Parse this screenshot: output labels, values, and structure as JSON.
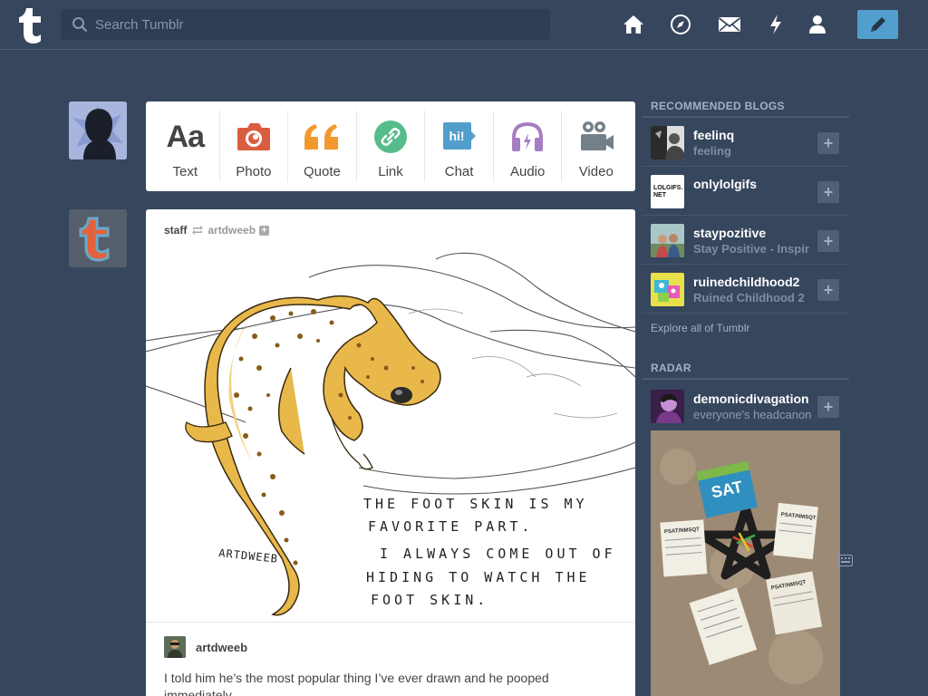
{
  "header": {
    "search_placeholder": "Search Tumblr",
    "nav": [
      "home-icon",
      "explore-compass-icon",
      "inbox-mail-icon",
      "activity-bolt-icon",
      "account-person-icon"
    ],
    "compose": "pencil-icon"
  },
  "post_types": [
    {
      "label": "Text",
      "icon": "text-aa-icon",
      "color": "#444444"
    },
    {
      "label": "Photo",
      "icon": "camera-icon",
      "color": "#d95e40"
    },
    {
      "label": "Quote",
      "icon": "quote-icon",
      "color": "#f2992e"
    },
    {
      "label": "Link",
      "icon": "link-icon",
      "color": "#56bc8a"
    },
    {
      "label": "Chat",
      "icon": "chat-bubble-icon",
      "color": "#529ecc"
    },
    {
      "label": "Audio",
      "icon": "headphones-icon",
      "color": "#a77dc2"
    },
    {
      "label": "Video",
      "icon": "video-camera-icon",
      "color": "#748089"
    }
  ],
  "post": {
    "blog": "staff",
    "source": "artdweeb",
    "image_text": {
      "signature": "ARTDWEEB",
      "line1": "THE FOOT SKIN IS MY",
      "line2": "FAVORITE PART.",
      "line3": "I ALWAYS COME OUT OF",
      "line4": "HIDING TO WATCH THE",
      "line5": "FOOT SKIN."
    },
    "caption_author": "artdweeb",
    "caption": "I told him he’s the most popular thing I’ve ever drawn and he pooped immediately."
  },
  "sidebar": {
    "recommended_title": "RECOMMENDED BLOGS",
    "recommended": [
      {
        "name": "feelinq",
        "sub": "feeling"
      },
      {
        "name": "onlylolgifs",
        "sub": "",
        "avatar_text": "LOLGIFS. NET"
      },
      {
        "name": "staypozitive",
        "sub": "Stay Positive - Inspir"
      },
      {
        "name": "ruinedchildhood2",
        "sub": "Ruined Childhood 2"
      }
    ],
    "explore": "Explore all of Tumblr",
    "radar_title": "RADAR",
    "radar": {
      "name": "demonicdivagation",
      "sub": "everyone's headcanon"
    },
    "radar_image": {
      "book_title": "SAT",
      "sheet_label_1": "PSAT/NMSQT",
      "sheet_label_2": "PSAT/NMSQT",
      "sheet_label_3": "PSAT/NMSQT"
    }
  }
}
